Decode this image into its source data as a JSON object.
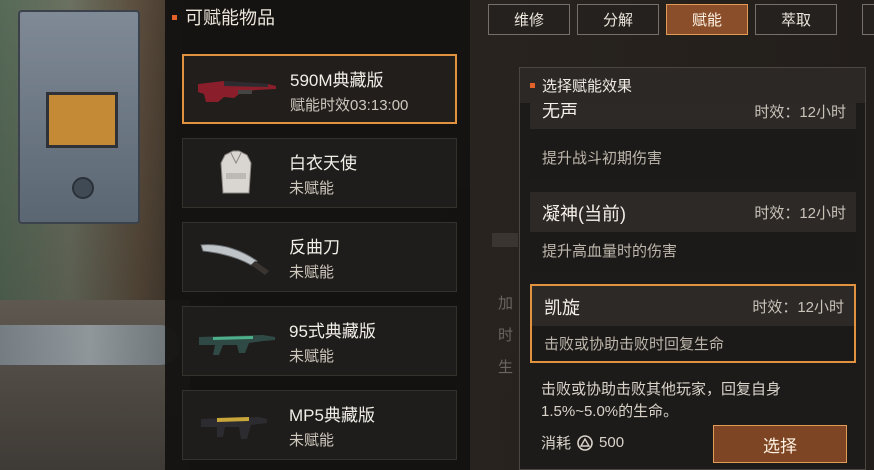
{
  "panel": {
    "title": "可赋能物品"
  },
  "items": [
    {
      "name": "590M典藏版",
      "status": "赋能时效03:13:00",
      "icon": "shotgun-icon"
    },
    {
      "name": "白衣天使",
      "status": "未赋能",
      "icon": "armor-vest-icon"
    },
    {
      "name": "反曲刀",
      "status": "未赋能",
      "icon": "kukri-knife-icon"
    },
    {
      "name": "95式典藏版",
      "status": "未赋能",
      "icon": "rifle-icon"
    },
    {
      "name": "MP5典藏版",
      "status": "未赋能",
      "icon": "smg-icon"
    }
  ],
  "tabs": [
    "维修",
    "分解",
    "赋能",
    "萃取"
  ],
  "active_tab": "赋能",
  "background_ghost": [
    "加",
    "时",
    "生"
  ],
  "dialog": {
    "title": "选择赋能效果",
    "effects": [
      {
        "name": "无声",
        "duration": "时效：12小时",
        "desc": "提升战斗初期伤害"
      },
      {
        "name": "凝神(当前)",
        "duration": "时效：12小时",
        "desc": "提升高血量时的伤害"
      },
      {
        "name": "凯旋",
        "duration": "时效：12小时",
        "desc": "击败或协助击败时回复生命"
      }
    ],
    "detail": "击败或协助击败其他玩家，回复自身1.5%~5.0%的生命。",
    "cost_label": "消耗",
    "cost_value": "500",
    "select_button": "选择"
  },
  "colors": {
    "accent": "#e0923e",
    "button_fill": "#7e4525",
    "bullet": "#e2622a"
  }
}
